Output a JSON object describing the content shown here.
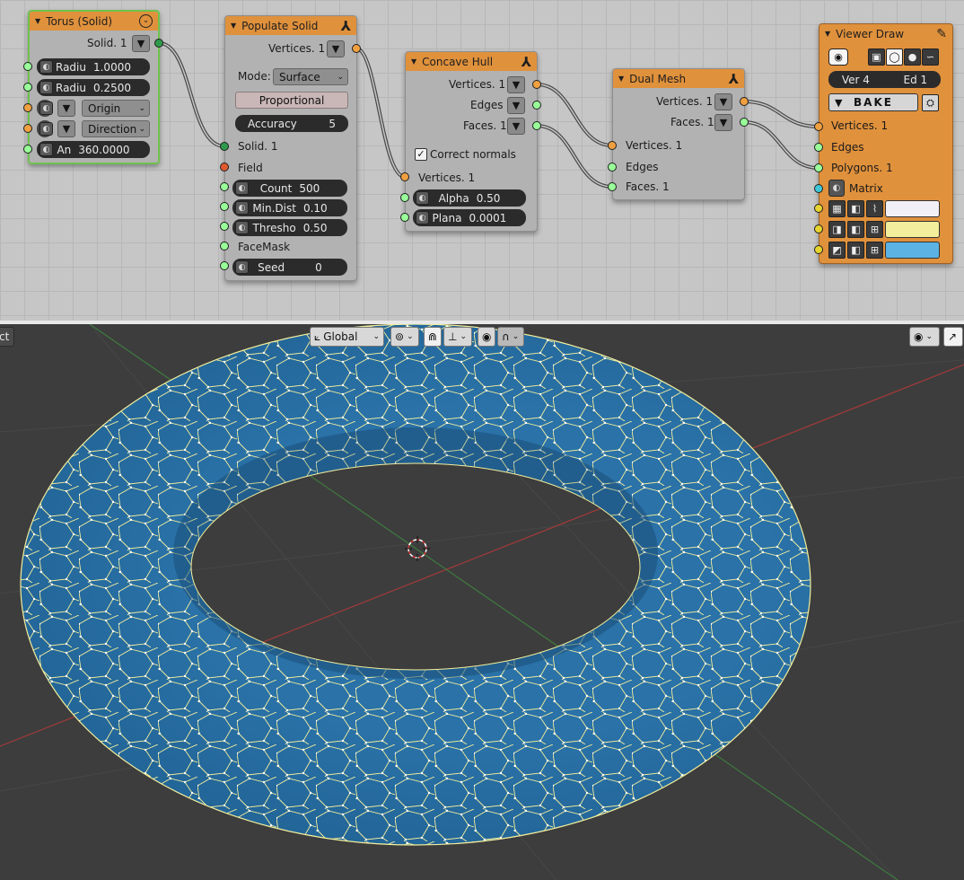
{
  "nodes": {
    "torus": {
      "title": "Torus (Solid)",
      "output": "Solid. 1",
      "radius_major": {
        "label": "Radiu",
        "value": "1.0000"
      },
      "radius_minor": {
        "label": "Radiu",
        "value": "0.2500"
      },
      "origin": "Origin",
      "direction": "Direction",
      "angle": {
        "label": "An",
        "value": "360.0000"
      }
    },
    "populate": {
      "title": "Populate Solid",
      "vertices": "Vertices. 1",
      "mode_label": "Mode:",
      "mode": "Surface",
      "proportional": "Proportional",
      "accuracy": {
        "label": "Accuracy",
        "value": "5"
      },
      "solid_in": "Solid. 1",
      "field": "Field",
      "count": {
        "label": "Count",
        "value": "500"
      },
      "min_dist": {
        "label": "Min.Dist",
        "value": "0.10"
      },
      "threshold": {
        "label": "Thresho",
        "value": "0.50"
      },
      "face_mask": "FaceMask",
      "seed": {
        "label": "Seed",
        "value": "0"
      }
    },
    "concave": {
      "title": "Concave Hull",
      "out_vertices": "Vertices. 1",
      "out_edges": "Edges",
      "out_faces": "Faces. 1",
      "correct_normals": "Correct normals",
      "in_vertices": "Vertices. 1",
      "alpha": {
        "label": "Alpha",
        "value": "0.50"
      },
      "planar": {
        "label": "Plana",
        "value": "0.0001"
      }
    },
    "dual": {
      "title": "Dual Mesh",
      "out_vertices": "Vertices. 1",
      "out_faces": "Faces. 1",
      "in_vertices": "Vertices. 1",
      "in_edges": "Edges",
      "in_faces": "Faces. 1"
    },
    "viewer": {
      "title": "Viewer Draw",
      "ver": {
        "label": "Ver",
        "value": "4"
      },
      "ed": {
        "label": "Ed",
        "value": "1"
      },
      "bake": "BAKE",
      "vertices": "Vertices. 1",
      "edges": "Edges",
      "polygons": "Polygons. 1",
      "matrix": "Matrix",
      "colors": {
        "vertex": "#f1f0f6",
        "edge": "#f3ee9b",
        "face": "#5cb3e3"
      }
    }
  },
  "viewport": {
    "left_label": "ct",
    "orientation": "Global"
  },
  "colors": {
    "node_header": "#e0913c",
    "socket_green": "#99ff99",
    "socket_orange": "#f0a040",
    "mesh_face": "#2a6fa3",
    "mesh_edge": "#f3ee9b"
  }
}
